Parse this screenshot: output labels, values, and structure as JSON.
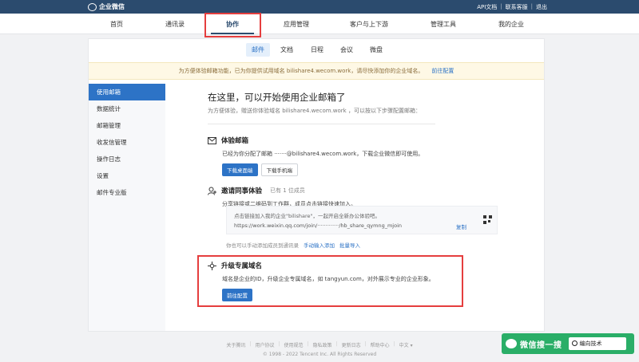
{
  "app": {
    "brand": "企业微信",
    "top_links": [
      "API文档",
      "联系客服",
      "退出"
    ]
  },
  "main_nav": [
    {
      "label": "首页"
    },
    {
      "label": "通讯录"
    },
    {
      "label": "协作",
      "active": true
    },
    {
      "label": "应用管理"
    },
    {
      "label": "客户与上下游"
    },
    {
      "label": "管理工具"
    },
    {
      "label": "我的企业"
    }
  ],
  "sub_tabs": [
    {
      "label": "邮件",
      "active": true
    },
    {
      "label": "文档"
    },
    {
      "label": "日程"
    },
    {
      "label": "会议"
    },
    {
      "label": "微盘"
    }
  ],
  "notice": {
    "text": "为方便体验邮箱功能，已为你提供试用域名 bilishare4.wecom.work，请尽快添加你的企业域名。",
    "link": "前往配置"
  },
  "sidebar": [
    {
      "label": "使用邮箱",
      "active": true
    },
    {
      "label": "数据统计"
    },
    {
      "label": "邮箱管理"
    },
    {
      "label": "收发信管理"
    },
    {
      "label": "操作日志"
    },
    {
      "label": "设置"
    },
    {
      "label": "邮件专业版"
    }
  ],
  "intro": {
    "title": "在这里，可以开始使用企业邮箱了",
    "subtitle": "为方便体验，赠送你体验域名 bilishare4.wecom.work ，可以按以下步骤配置邮箱："
  },
  "section_trial": {
    "icon": "mail-icon",
    "title": "体验邮箱",
    "desc": "已经为你分配了邮箱 ·······@bilishare4.wecom.work，下载企业微信即可使用。",
    "btn_desktop": "下载桌面端",
    "btn_mobile": "下载手机端"
  },
  "section_invite": {
    "icon": "add-user-icon",
    "title": "邀请同事体验",
    "member_count": "已有 1 位成员",
    "desc": "分享链接或二维码到工作群，成员点击链接快速加入。",
    "invite_text": "点击链接加入我的企业\"bilishare\"，一起开启全新办公体验吧。",
    "invite_url": "https://work.weixin.qq.com/join/·············/hb_share_qymng_mjoin",
    "copy_label": "复制",
    "manual_hint": "你也可以手动添加成员到通讯录",
    "manual_add": "手动输入添加",
    "batch_import": "批量导入"
  },
  "section_domain": {
    "icon": "globe-icon",
    "title": "升级专属域名",
    "desc": "域名是企业的ID，升级企业专属域名，如 tangyun.com，对外展示专业的企业形象。",
    "btn": "前往配置"
  },
  "footer": {
    "links": [
      "关于腾讯",
      "用户协议",
      "使用规范",
      "隐私政策",
      "更新日志",
      "帮助中心",
      "中文 ▾"
    ],
    "copyright": "© 1998 - 2022 Tencent Inc. All Rights Reserved"
  },
  "watermark": {
    "text": "微信搜一搜",
    "search": "编向技术"
  },
  "colors": {
    "topbar": "#2b4b6e",
    "accent": "#2d73c6",
    "highlight_box": "#e53e3e",
    "notice_bg": "#fef8e5"
  }
}
